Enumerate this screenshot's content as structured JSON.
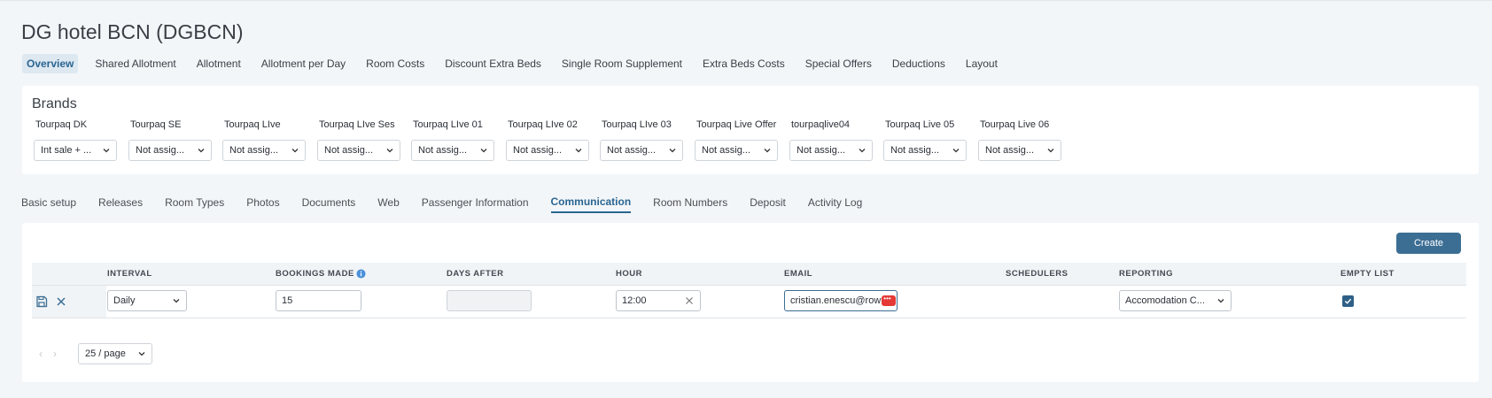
{
  "header": {
    "title": "DG hotel BCN (DGBCN)"
  },
  "top_nav": [
    {
      "label": "Overview",
      "active": true
    },
    {
      "label": "Shared Allotment"
    },
    {
      "label": "Allotment"
    },
    {
      "label": "Allotment per Day"
    },
    {
      "label": "Room Costs"
    },
    {
      "label": "Discount Extra Beds"
    },
    {
      "label": "Single Room Supplement"
    },
    {
      "label": "Extra Beds Costs"
    },
    {
      "label": "Special Offers"
    },
    {
      "label": "Deductions"
    },
    {
      "label": "Layout"
    }
  ],
  "brands": {
    "title": "Brands",
    "items": [
      {
        "label": "Tourpaq DK",
        "value": "Int sale + ..."
      },
      {
        "label": "Tourpaq SE",
        "value": "Not assig..."
      },
      {
        "label": "Tourpaq LIve",
        "value": "Not assig..."
      },
      {
        "label": "Tourpaq LIve Ses",
        "value": "Not assig..."
      },
      {
        "label": "Tourpaq LIve 01",
        "value": "Not assig..."
      },
      {
        "label": "Tourpaq LIve 02",
        "value": "Not assig..."
      },
      {
        "label": "Tourpaq LIve 03",
        "value": "Not assig..."
      },
      {
        "label": "Tourpaq Live Offer",
        "value": "Not assig..."
      },
      {
        "label": "tourpaqlive04",
        "value": "Not assig..."
      },
      {
        "label": "Tourpaq Live 05",
        "value": "Not assig..."
      },
      {
        "label": "Tourpaq Live 06",
        "value": "Not assig..."
      }
    ]
  },
  "sub_tabs": [
    {
      "label": "Basic setup"
    },
    {
      "label": "Releases"
    },
    {
      "label": "Room Types"
    },
    {
      "label": "Photos"
    },
    {
      "label": "Documents"
    },
    {
      "label": "Web"
    },
    {
      "label": "Passenger Information"
    },
    {
      "label": "Communication",
      "active": true
    },
    {
      "label": "Room Numbers"
    },
    {
      "label": "Deposit"
    },
    {
      "label": "Activity Log"
    }
  ],
  "toolbar": {
    "create_label": "Create"
  },
  "table": {
    "columns": {
      "interval": "INTERVAL",
      "bookings_made": "BOOKINGS MADE",
      "days_after": "DAYS AFTER",
      "hour": "HOUR",
      "email": "EMAIL",
      "schedulers": "SCHEDULERS",
      "reporting": "REPORTING",
      "empty_list": "EMPTY LIST"
    },
    "row": {
      "interval": "Daily",
      "bookings_made": "15",
      "days_after": "",
      "hour": "12:00",
      "email": "cristian.enescu@row",
      "schedulers": "",
      "reporting": "Accomodation C...",
      "empty_list": true
    }
  },
  "pagination": {
    "prev": "‹",
    "next": "›",
    "page_size": "25 / page"
  },
  "colors": {
    "accent": "#2a6591",
    "button": "#3c6e94",
    "background": "#f3f6f9"
  }
}
